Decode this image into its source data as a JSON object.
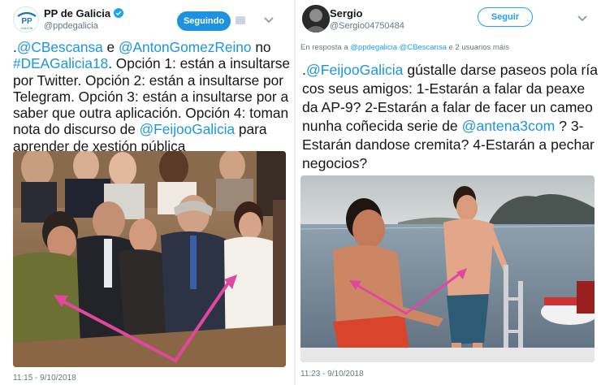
{
  "left_tweet": {
    "avatar_label": "PP",
    "avatar_sublabel": "GALICIA",
    "name": "PP de Galicia",
    "handle": "@ppdegalicia",
    "follow_button": "Seguindo",
    "text_parts": [
      {
        "t": ".",
        "link": false
      },
      {
        "t": "@CBescansa",
        "link": true
      },
      {
        "t": " e ",
        "link": false
      },
      {
        "t": "@AntonGomezReino",
        "link": true
      },
      {
        "t": " no ",
        "link": false
      },
      {
        "t": "#DEAGalicia18",
        "link": true
      },
      {
        "t": ". Opción 1: están a insultarse por Twitter. Opción 2: están a insultarse por Telegram. Opción 3: están a insultarse por a saber que outra aplicación. Opción 4: toman nota do discurso de ",
        "link": false
      },
      {
        "t": "@FeijooGalicia",
        "link": true
      },
      {
        "t": " para aprender de xestión pública",
        "link": false
      }
    ],
    "timestamp": "11:15 - 9/10/2018"
  },
  "right_tweet": {
    "name": "Sergio",
    "handle": "@Sergio04750484",
    "follow_button": "Seguir",
    "reply_prefix": "En resposta a ",
    "reply_user_1": "@ppdegalicia",
    "reply_user_2": "@CBescansa",
    "reply_suffix": " e 2 usuarios máis",
    "text_parts": [
      {
        "t": ".",
        "link": false
      },
      {
        "t": "@FeijooGalicia",
        "link": true
      },
      {
        "t": " gústalle darse paseos pola ría cos seus amigos: 1-Estarán a falar da peaxe da AP-9? 2-Estarán a falar de facer un cameo nunha coñecida serie de ",
        "link": false
      },
      {
        "t": "@antena3com",
        "link": true
      },
      {
        "t": " ? 3-Estarán  dandose cremita? 4-Estarán a pechar negocios?",
        "link": false
      }
    ],
    "timestamp": "11:23 - 9/10/2018"
  },
  "colors": {
    "link": "#1b95e0",
    "verified": "#1da1f2",
    "following_bg": "#1d92e3",
    "arrow": "#e0489e"
  },
  "icons": [
    "pp-logo-icon",
    "verified-badge-icon",
    "chevron-down-icon",
    "dm-icon"
  ]
}
